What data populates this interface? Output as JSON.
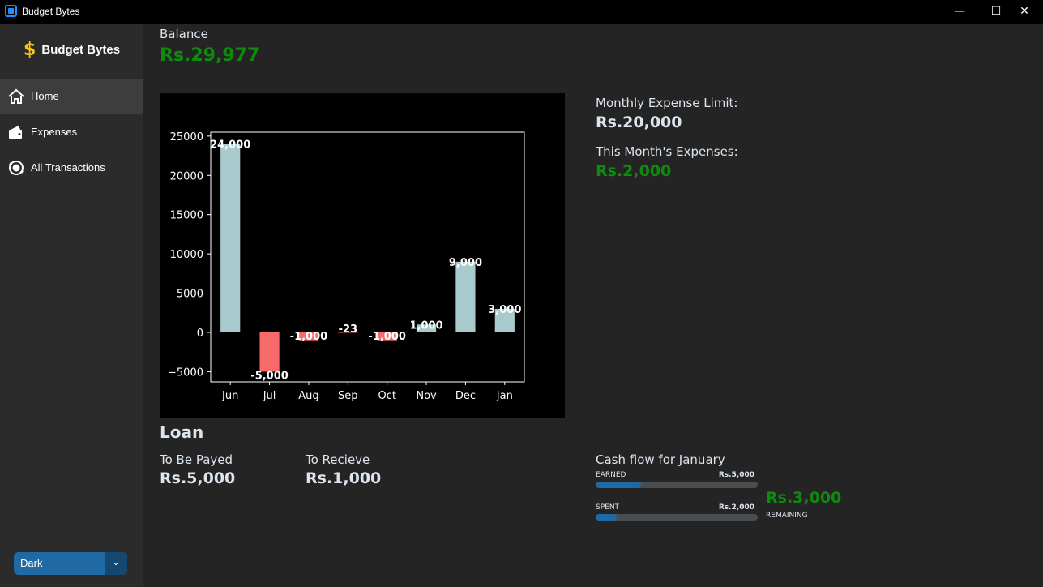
{
  "window": {
    "title": "Budget Bytes",
    "controls": {
      "minimize": "—",
      "maximize": "☐",
      "close": "✕"
    }
  },
  "sidebar": {
    "brand": {
      "icon": "dollar-icon",
      "symbol": "$",
      "label": "Budget Bytes"
    },
    "items": [
      {
        "label": "Home",
        "icon": "home-icon",
        "active": true
      },
      {
        "label": "Expenses",
        "icon": "wallet-icon",
        "active": false
      },
      {
        "label": "All Transactions",
        "icon": "transactions-icon",
        "active": false
      }
    ],
    "theme": {
      "value": "Dark",
      "arrow": "⌄"
    }
  },
  "balance": {
    "label": "Balance",
    "value": "Rs.29,977"
  },
  "limits": {
    "limit_label": "Monthly Expense Limit:",
    "limit_value": "Rs.20,000",
    "expenses_label": "This Month's Expenses:",
    "expenses_value": "Rs.2,000"
  },
  "loan": {
    "title": "Loan",
    "payed_label": "To Be Payed",
    "payed_value": "Rs.5,000",
    "recieve_label": "To Recieve",
    "recieve_value": "Rs.1,000"
  },
  "cashflow": {
    "title": "Cash flow for January",
    "earned_label": "EARNED",
    "earned_value": "Rs.5,000",
    "earned_fraction": 0.28,
    "spent_label": "SPENT",
    "spent_value": "Rs.2,000",
    "spent_fraction": 0.13,
    "remaining_value": "Rs.3,000",
    "remaining_label": "REMAINING"
  },
  "colors": {
    "positive_bar": "#a8cacc",
    "negative_bar": "#f96a6a",
    "green_text": "#0f8a0f",
    "accent": "#1f6aa5"
  },
  "chart_data": {
    "type": "bar",
    "categories": [
      "Jun",
      "Jul",
      "Aug",
      "Sep",
      "Oct",
      "Nov",
      "Dec",
      "Jan"
    ],
    "values": [
      24000,
      -5000,
      -1000,
      -23,
      -1000,
      1000,
      9000,
      3000
    ],
    "data_labels": [
      "24,000",
      "-5,000",
      "-1,000",
      "-23",
      "-1,000",
      "1,000",
      "9,000",
      "3,000"
    ],
    "yticks": [
      -5000,
      0,
      5000,
      10000,
      15000,
      20000,
      25000
    ],
    "ytick_labels": [
      "−5000",
      "0",
      "5000",
      "10000",
      "15000",
      "20000",
      "25000"
    ],
    "ylim": [
      -6300,
      25500
    ],
    "title": "",
    "xlabel": "",
    "ylabel": "",
    "grid": false
  }
}
